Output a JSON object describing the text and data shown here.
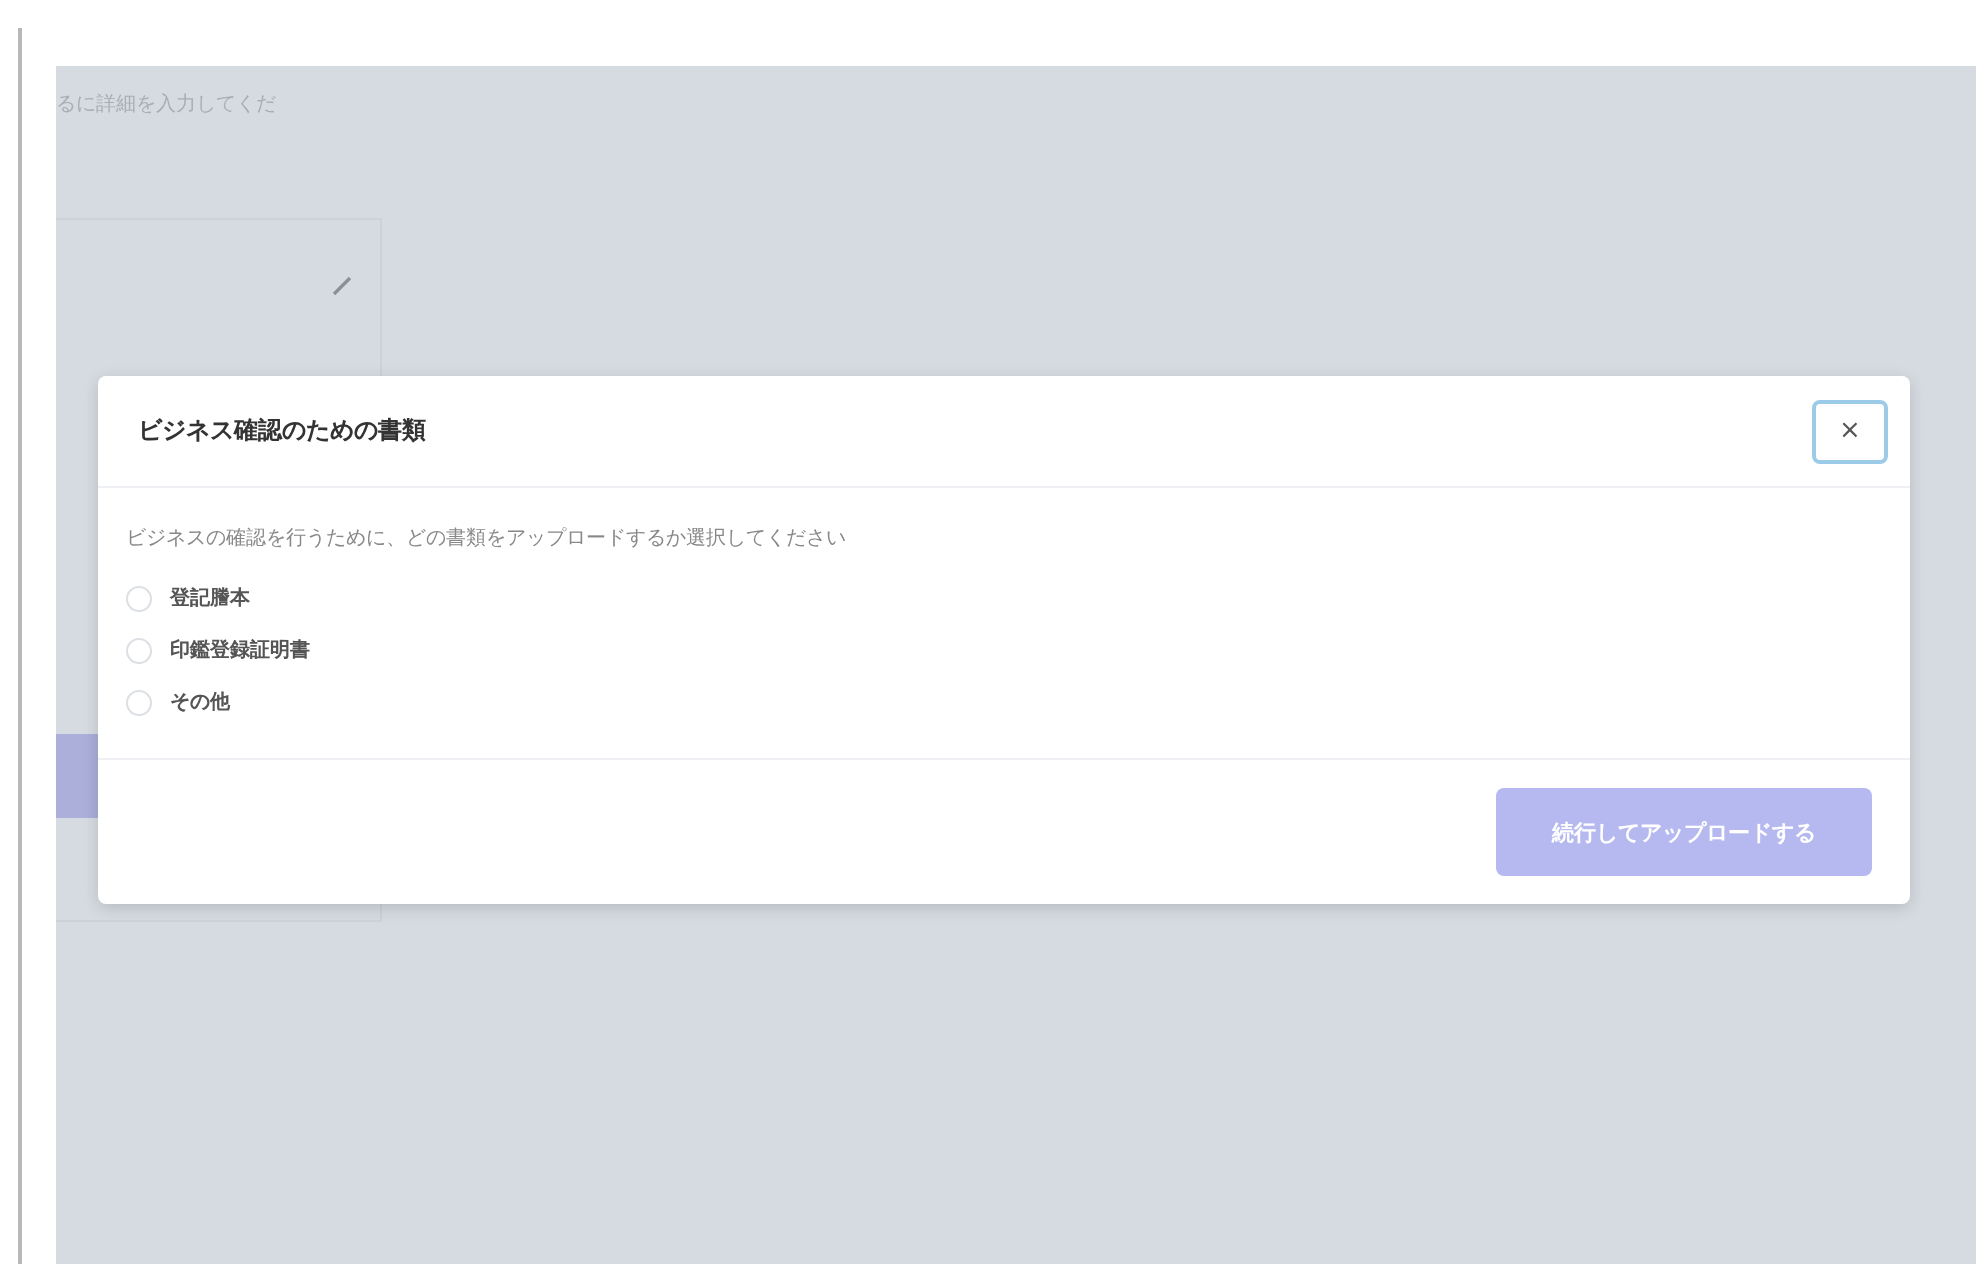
{
  "background": {
    "hint": "るに詳細を入力してくだ",
    "card_accent": true
  },
  "dialog": {
    "title": "ビジネス確認のための書類",
    "close": "×",
    "prompt": "ビジネスの確認を行うために、どの書類をアップロードするか選択してください",
    "options": [
      {
        "label": "登記謄本",
        "selected": false
      },
      {
        "label": "印鑑登録証明書",
        "selected": false
      },
      {
        "label": "その他",
        "selected": false
      }
    ],
    "submit": {
      "label": "続行してアップロードする",
      "disabled": true
    }
  }
}
